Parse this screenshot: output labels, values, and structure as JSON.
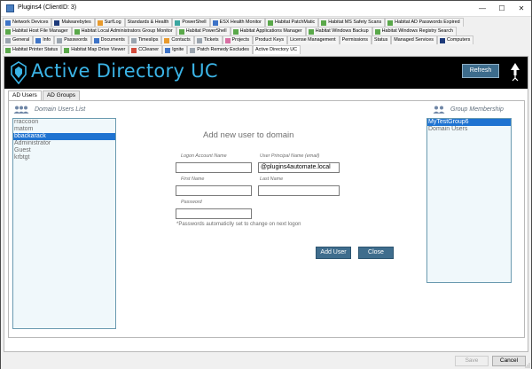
{
  "window": {
    "title": "Plugins4    (ClientID: 3)",
    "controls": {
      "minimize": "—",
      "maximize": "☐",
      "close": "✕"
    }
  },
  "tabs": {
    "row1": [
      {
        "label": "Network Devices",
        "icon": "network-icon",
        "color": "#3d73c7"
      },
      {
        "label": "Malwarebytes",
        "icon": "malwarebytes-icon",
        "color": "#1d3a7a"
      },
      {
        "label": "SurfLog",
        "icon": "surflog-icon",
        "color": "#e89a2c"
      },
      {
        "label": "Standards & Health",
        "icon": "none"
      },
      {
        "label": "PowerShell",
        "icon": "powershell-icon",
        "color": "#3aa6a0"
      },
      {
        "label": "ESX Health Monitor",
        "icon": "esx-icon",
        "color": "#3d73c7"
      },
      {
        "label": "Habitat PatchMatic",
        "icon": "habitat-icon",
        "color": "#5aa84a"
      },
      {
        "label": "Habitat MS Safety Scans",
        "icon": "habitat-icon",
        "color": "#5aa84a"
      },
      {
        "label": "Habitat AD Passwords Expired",
        "icon": "habitat-icon",
        "color": "#5aa84a"
      }
    ],
    "row2": [
      {
        "label": "Habitat Host File Manager",
        "icon": "habitat-icon",
        "color": "#5aa84a"
      },
      {
        "label": "Habitat Local Administrators Group Monitor",
        "icon": "habitat-icon",
        "color": "#5aa84a"
      },
      {
        "label": "Habitat PowerShell",
        "icon": "habitat-icon",
        "color": "#5aa84a"
      },
      {
        "label": "Habitat Applications Manager",
        "icon": "habitat-icon",
        "color": "#5aa84a"
      },
      {
        "label": "Habitat Windows Backup",
        "icon": "habitat-icon",
        "color": "#5aa84a"
      },
      {
        "label": "Habitat Windows Registry Search",
        "icon": "habitat-icon",
        "color": "#5aa84a"
      }
    ],
    "row3": [
      {
        "label": "General",
        "icon": "general-icon",
        "color": "#9aa4ae"
      },
      {
        "label": "Info",
        "icon": "info-icon",
        "color": "#3d73c7"
      },
      {
        "label": "Passwords",
        "icon": "passwords-icon",
        "color": "#9aa4ae"
      },
      {
        "label": "Documents",
        "icon": "documents-icon",
        "color": "#3d73c7"
      },
      {
        "label": "Timeslips",
        "icon": "timeslips-icon",
        "color": "#9aa4ae"
      },
      {
        "label": "Contacts",
        "icon": "contacts-icon",
        "color": "#e89a2c"
      },
      {
        "label": "Tickets",
        "icon": "tickets-icon",
        "color": "#9aa4ae"
      },
      {
        "label": "Projects",
        "icon": "projects-icon",
        "color": "#d96fa3"
      },
      {
        "label": "Product Keys",
        "icon": "none"
      },
      {
        "label": "License Management",
        "icon": "none"
      },
      {
        "label": "Permissions",
        "icon": "none"
      },
      {
        "label": "Status",
        "icon": "none"
      },
      {
        "label": "Managed Services",
        "icon": "none"
      },
      {
        "label": "Computers",
        "icon": "computers-icon",
        "color": "#1d3a7a"
      }
    ],
    "row4": [
      {
        "label": "Habitat Printer Status",
        "icon": "habitat-icon",
        "color": "#5aa84a"
      },
      {
        "label": "Habitat Map Drive Viewer",
        "icon": "habitat-icon",
        "color": "#5aa84a"
      },
      {
        "label": "CCleaner",
        "icon": "ccleaner-icon",
        "color": "#d24a3a"
      },
      {
        "label": "Ignite",
        "icon": "ignite-icon",
        "color": "#3d73c7"
      },
      {
        "label": "Patch Remedy Excludes",
        "icon": "patch-icon",
        "color": "#9aa4ae"
      },
      {
        "label": "Active Directory UC",
        "icon": "none",
        "active": true
      }
    ]
  },
  "banner": {
    "title": "Active Directory UC",
    "refresh_label": "Refresh",
    "accent": "#3bb4e6",
    "button_color": "#3d6c8c"
  },
  "subtabs": {
    "ad_users": "AD Users",
    "ad_groups": "AD Groups"
  },
  "users_list": {
    "header": "Domain Users List",
    "items": [
      "rraccoon",
      "matom",
      "bbackarack",
      "Administrator",
      "Guest",
      "krbtgt"
    ],
    "selected": "bbackarack"
  },
  "groups_list": {
    "header": "Group Membership",
    "items": [
      "MyTestGroup6",
      "Domain Users"
    ],
    "selected": "MyTestGroup6"
  },
  "form": {
    "title": "Add new user to domain",
    "logon_label": "Logon Account Name",
    "logon_value": "",
    "upn_label": "User Principal Name (email)",
    "upn_value": "@plugins4automate.local",
    "first_label": "First Name",
    "first_value": "",
    "last_label": "Last Name",
    "last_value": "",
    "password_label": "Password",
    "password_value": "",
    "hint": "*Passwords automaticlly set to change on next logon",
    "add_label": "Add User",
    "close_label": "Close"
  },
  "footer": {
    "save_label": "Save",
    "cancel_label": "Cancel"
  }
}
